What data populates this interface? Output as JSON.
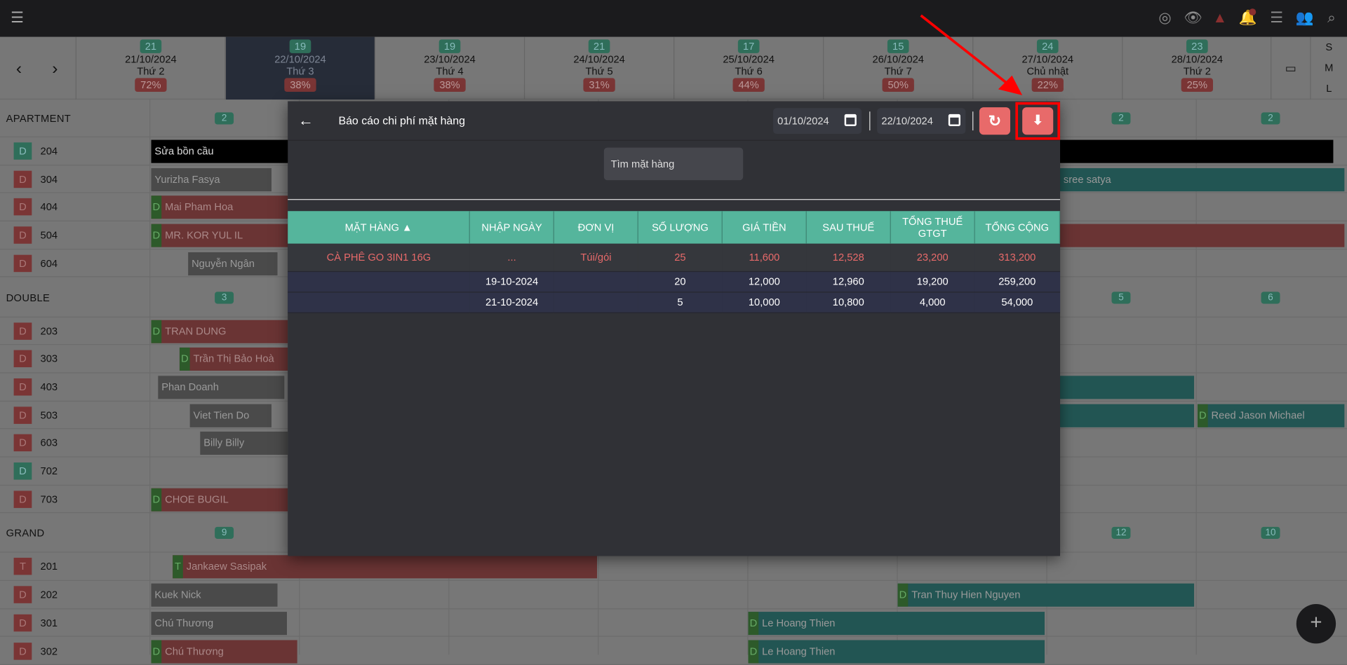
{
  "topbar": {
    "menu_icon": "hamburger-icon",
    "icons": [
      "fingerprint-icon",
      "eye-icon",
      "warning-icon",
      "bell-icon",
      "list-icon",
      "add-user-icon",
      "search-icon"
    ]
  },
  "datenav": {
    "prev": "‹",
    "next": "›",
    "calendar_icon": "calendar-icon",
    "sizes": [
      "S",
      "M",
      "L"
    ],
    "days": [
      {
        "count": "21",
        "date": "21/10/2024",
        "weekday": "Thứ 2",
        "occupancy": "72%"
      },
      {
        "count": "19",
        "date": "22/10/2024",
        "weekday": "Thứ 3",
        "occupancy": "38%",
        "selected": true
      },
      {
        "count": "19",
        "date": "23/10/2024",
        "weekday": "Thứ 4",
        "occupancy": "38%"
      },
      {
        "count": "21",
        "date": "24/10/2024",
        "weekday": "Thứ 5",
        "occupancy": "31%"
      },
      {
        "count": "17",
        "date": "25/10/2024",
        "weekday": "Thứ 6",
        "occupancy": "44%"
      },
      {
        "count": "15",
        "date": "26/10/2024",
        "weekday": "Thứ 7",
        "occupancy": "50%"
      },
      {
        "count": "24",
        "date": "27/10/2024",
        "weekday": "Chủ nhật",
        "occupancy": "22%"
      },
      {
        "count": "23",
        "date": "28/10/2024",
        "weekday": "Thứ 2",
        "occupancy": "25%"
      }
    ]
  },
  "groups": [
    {
      "name": "APARTMENT",
      "badges": [
        "2",
        "2",
        "2"
      ],
      "rooms": [
        {
          "tag": "D",
          "status": "teal",
          "number": "204"
        },
        {
          "tag": "D",
          "status": "red",
          "number": "304"
        },
        {
          "tag": "D",
          "status": "red",
          "number": "404"
        },
        {
          "tag": "D",
          "status": "red",
          "number": "504"
        },
        {
          "tag": "D",
          "status": "red",
          "number": "604"
        }
      ]
    },
    {
      "name": "DOUBLE",
      "badges": [
        "3",
        "5",
        "6"
      ],
      "rooms": [
        {
          "tag": "D",
          "status": "red",
          "number": "203"
        },
        {
          "tag": "D",
          "status": "red",
          "number": "303"
        },
        {
          "tag": "D",
          "status": "red",
          "number": "403"
        },
        {
          "tag": "D",
          "status": "red",
          "number": "503"
        },
        {
          "tag": "D",
          "status": "red",
          "number": "603"
        },
        {
          "tag": "D",
          "status": "teal",
          "number": "702"
        },
        {
          "tag": "D",
          "status": "red",
          "number": "703"
        }
      ]
    },
    {
      "name": "GRAND",
      "badges": [
        "9",
        "12",
        "10"
      ],
      "rooms": [
        {
          "tag": "T",
          "status": "red",
          "number": "201"
        },
        {
          "tag": "D",
          "status": "red",
          "number": "202"
        },
        {
          "tag": "D",
          "status": "red",
          "number": "301"
        },
        {
          "tag": "D",
          "status": "red",
          "number": "302"
        }
      ]
    }
  ],
  "bookings": [
    {
      "room": "204",
      "guest": "Sửa bồn cầu",
      "kind": "black"
    },
    {
      "room": "304",
      "guest": "Yurizha Fasya",
      "kind": "gray"
    },
    {
      "room": "304",
      "guest": "sree satya",
      "kind": "teal"
    },
    {
      "room": "404",
      "guest": "Mai Pham Hoa",
      "kind": "red",
      "tag": "D"
    },
    {
      "room": "504",
      "guest": "MR. KOR YUL IL",
      "kind": "red",
      "tag": "D"
    },
    {
      "room": "604",
      "guest": "Nguyễn Ngân",
      "kind": "gray"
    },
    {
      "room": "203",
      "guest": "TRAN DUNG",
      "kind": "red",
      "tag": "D"
    },
    {
      "room": "303",
      "guest": "Trần Thị Bảo Hoà",
      "kind": "red",
      "tag": "D"
    },
    {
      "room": "403",
      "guest": "Phan Doanh",
      "kind": "gray"
    },
    {
      "room": "403",
      "guest": "",
      "kind": "teal"
    },
    {
      "room": "503",
      "guest": "Viet Tien Do",
      "kind": "gray"
    },
    {
      "room": "503",
      "guest": "",
      "kind": "teal"
    },
    {
      "room": "503",
      "guest": "Reed Jason Michael",
      "kind": "teal",
      "tag": "D"
    },
    {
      "room": "603",
      "guest": "Billy Billy",
      "kind": "gray"
    },
    {
      "room": "703",
      "guest": "CHOE BUGIL",
      "kind": "red",
      "tag": "D"
    },
    {
      "room": "201",
      "guest": "Jankaew Sasipak",
      "kind": "red",
      "tag": "T"
    },
    {
      "room": "202",
      "guest": "Kuek Nick",
      "kind": "gray"
    },
    {
      "room": "202",
      "guest": "Tran Thuy Hien Nguyen",
      "kind": "teal",
      "tag": "D"
    },
    {
      "room": "301",
      "guest": "Chú Thương",
      "kind": "gray"
    },
    {
      "room": "301",
      "guest": "Le Hoang Thien",
      "kind": "teal",
      "tag": "D"
    },
    {
      "room": "302",
      "guest": "Chú Thương",
      "kind": "red",
      "tag": "D"
    },
    {
      "room": "302",
      "guest": "Le Hoang Thien",
      "kind": "teal",
      "tag": "D"
    }
  ],
  "dialog": {
    "title": "Báo cáo chi phí mặt hàng",
    "back_icon": "←",
    "from_date": "01/10/2024",
    "to_date": "22/10/2024",
    "refresh_icon": "↻",
    "download_icon": "⬇",
    "search_placeholder": "Tìm mặt hàng",
    "columns": [
      "MẶT HÀNG ▲",
      "NHẬP NGÀY",
      "ĐƠN VỊ",
      "SỐ LƯỢNG",
      "GIÁ TIỀN",
      "SAU THUẾ",
      "TỔNG THUẾ GTGT",
      "TỔNG CỘNG"
    ],
    "rows": [
      {
        "type": "main",
        "cells": [
          "CÀ PHÊ GO 3IN1 16G",
          "...",
          "Túi/gói",
          "25",
          "11,600",
          "12,528",
          "23,200",
          "313,200"
        ]
      },
      {
        "type": "sub",
        "cells": [
          "",
          "19-10-2024",
          "",
          "20",
          "12,000",
          "12,960",
          "19,200",
          "259,200"
        ]
      },
      {
        "type": "sub",
        "cells": [
          "",
          "21-10-2024",
          "",
          "5",
          "10,000",
          "10,800",
          "4,000",
          "54,000"
        ]
      }
    ],
    "accent": "#55b59c",
    "button_color": "#e86a6a"
  },
  "fab": {
    "label": "+"
  }
}
